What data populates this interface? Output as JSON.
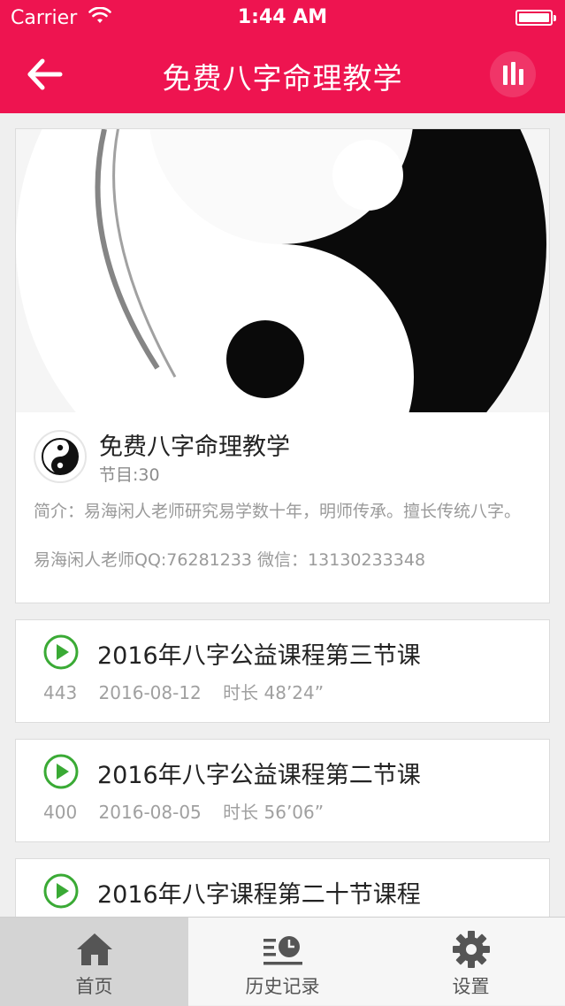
{
  "status_bar": {
    "carrier": "Carrier",
    "time": "1:44 AM"
  },
  "nav": {
    "title": "免费八字命理教学",
    "back_icon": "back-arrow-icon",
    "right_icon": "audio-bars-icon"
  },
  "album": {
    "title": "免费八字命理教学",
    "count": "节目:30",
    "description": "简介：易海闲人老师研究易学数十年，明师传承。擅长传统八字。",
    "contact": "易海闲人老师QQ:76281233  微信：13130233348"
  },
  "episodes": [
    {
      "title": "2016年八字公益课程第三节课",
      "plays": "443",
      "date": "2016-08-12",
      "duration": "时长 48’24”"
    },
    {
      "title": "2016年八字公益课程第二节课",
      "plays": "400",
      "date": "2016-08-05",
      "duration": "时长 56’06”"
    },
    {
      "title": "2016年八字课程第二十节课程"
    }
  ],
  "tabbar": {
    "items": [
      {
        "label": "首页",
        "icon": "home-icon",
        "active": true
      },
      {
        "label": "历史记录",
        "icon": "history-icon",
        "active": false
      },
      {
        "label": "设置",
        "icon": "gear-icon",
        "active": false
      }
    ]
  },
  "colors": {
    "brand_red": "#ee1450",
    "play_green": "#3aaa35"
  }
}
